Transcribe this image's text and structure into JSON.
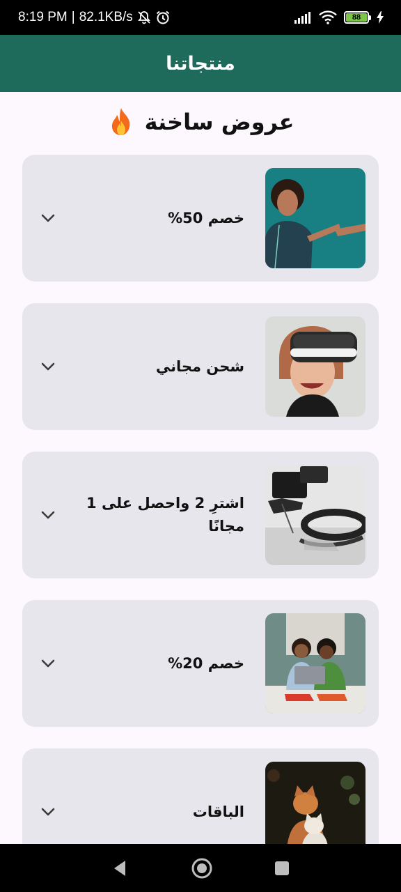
{
  "status_bar": {
    "time": "8:19 PM",
    "network_speed": "82.1KB/s",
    "battery_level": "88",
    "icons": [
      "bell-off-icon",
      "alarm-icon",
      "signal-icon",
      "wifi-icon",
      "battery-icon",
      "charging-icon"
    ]
  },
  "app_bar": {
    "title": "منتجاتنا"
  },
  "section": {
    "title": "عروض ساخنة",
    "icon": "fire-icon"
  },
  "offers": [
    {
      "title": "خصم 50%",
      "thumbnail": "man-pointing-photo",
      "icon": "chevron-down-icon"
    },
    {
      "title": "شحن مجاني",
      "thumbnail": "woman-vr-headset-photo",
      "icon": "chevron-down-icon"
    },
    {
      "title": "اشترِ 2 واحصل على 1 مجانًا",
      "thumbnail": "ar-headset-photo",
      "icon": "chevron-down-icon"
    },
    {
      "title": "خصم 20%",
      "thumbnail": "couple-laptop-photo",
      "icon": "chevron-down-icon"
    },
    {
      "title": "الباقات",
      "thumbnail": "cats-photo",
      "icon": "chevron-down-icon"
    }
  ],
  "colors": {
    "app_bar": "#1f6b5b",
    "card_background": "#e7e6ec",
    "page_background": "#fdf8fd"
  },
  "nav_bar": {
    "buttons": [
      "back-icon",
      "home-icon",
      "recents-icon"
    ]
  }
}
